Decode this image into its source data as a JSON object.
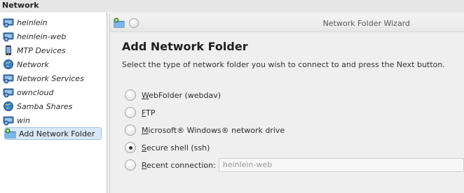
{
  "window": {
    "title": "Network"
  },
  "sidebar": {
    "items": [
      {
        "label": "heinlein",
        "icon": "network-drive-icon"
      },
      {
        "label": "heinlein-web",
        "icon": "network-drive-icon"
      },
      {
        "label": "MTP Devices",
        "icon": "phone-device-icon"
      },
      {
        "label": "Network",
        "icon": "globe-icon"
      },
      {
        "label": "Network Services",
        "icon": "network-drive-icon"
      },
      {
        "label": "owncloud",
        "icon": "network-drive-icon"
      },
      {
        "label": "Samba Shares",
        "icon": "globe-icon"
      },
      {
        "label": "win",
        "icon": "network-drive-icon"
      },
      {
        "label": "Add Network Folder",
        "icon": "folder-add-icon",
        "selected": true
      }
    ]
  },
  "dialog": {
    "title": "Network Folder Wizard",
    "heading": "Add Network Folder",
    "instruction": "Select the type of network folder you wish to connect to and press the Next button.",
    "options": [
      {
        "pre": "",
        "mnemonic": "W",
        "post": "ebFolder (webdav)",
        "checked": false
      },
      {
        "pre": "",
        "mnemonic": "F",
        "post": "TP",
        "checked": false
      },
      {
        "pre": "",
        "mnemonic": "M",
        "post": "icrosoft® Windows® network drive",
        "checked": false
      },
      {
        "pre": "",
        "mnemonic": "S",
        "post": "ecure shell (ssh)",
        "checked": true
      },
      {
        "pre": "",
        "mnemonic": "R",
        "post": "ecent connection:",
        "checked": false
      }
    ],
    "recent_connection_value": "heinlein-web"
  },
  "colors": {
    "selection_bg": "#d8e8f7",
    "selection_border": "#9cc1e6",
    "window_bg": "#efefef"
  }
}
